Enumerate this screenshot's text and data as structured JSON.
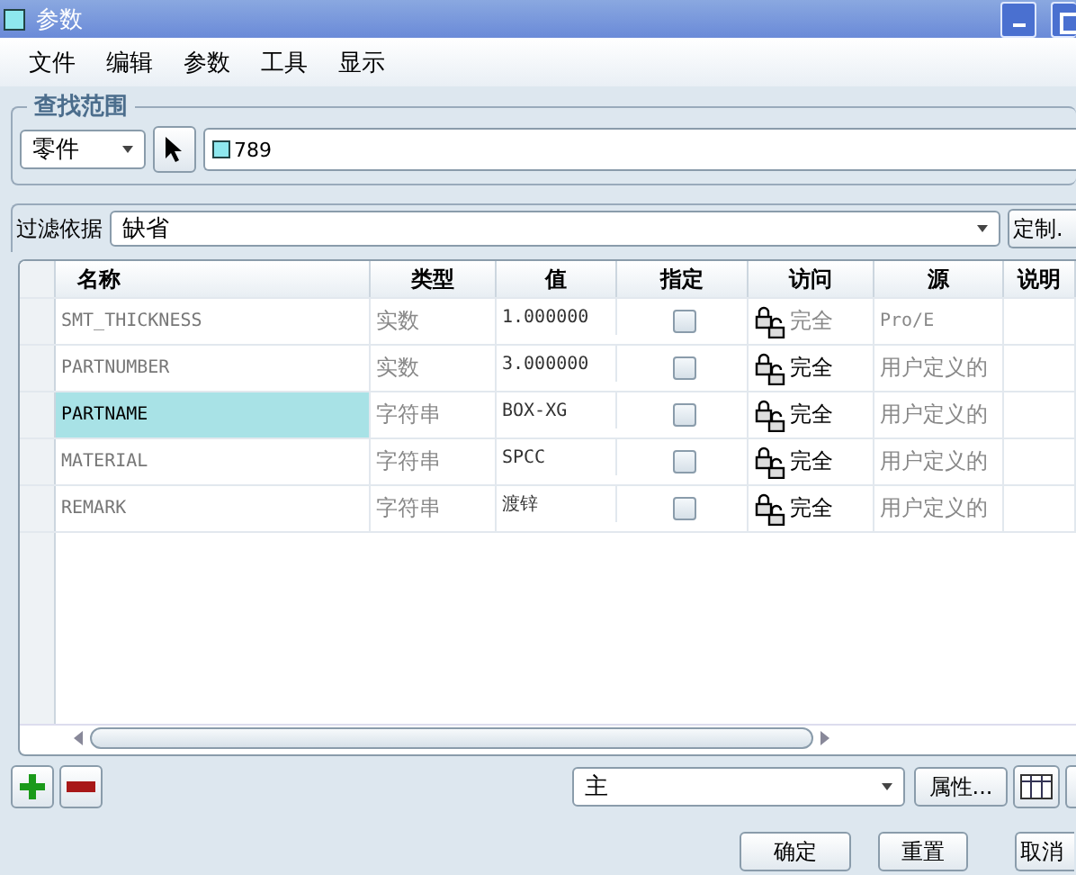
{
  "window": {
    "title": "参数"
  },
  "menu": [
    "文件",
    "编辑",
    "参数",
    "工具",
    "显示"
  ],
  "scope": {
    "title": "查找范围",
    "type_value": "零件",
    "model_value": "789"
  },
  "filter": {
    "label": "过滤依据",
    "value": "缺省",
    "button": "定制."
  },
  "table": {
    "columns": [
      "名称",
      "类型",
      "值",
      "指定",
      "访问",
      "源",
      "说明"
    ],
    "rows": [
      {
        "name": "SMT_THICKNESS",
        "type": "实数",
        "value": "1.000000",
        "designated": false,
        "access": "完全",
        "source": "Pro/E",
        "selected": false,
        "locked": true
      },
      {
        "name": "PARTNUMBER",
        "type": "实数",
        "value": "3.000000",
        "designated": false,
        "access": "完全",
        "source": "用户定义的",
        "selected": false,
        "locked": false
      },
      {
        "name": "PARTNAME",
        "type": "字符串",
        "value": "BOX-XG",
        "designated": false,
        "access": "完全",
        "source": "用户定义的",
        "selected": true,
        "locked": false
      },
      {
        "name": "MATERIAL",
        "type": "字符串",
        "value": "SPCC",
        "designated": false,
        "access": "完全",
        "source": "用户定义的",
        "selected": false,
        "locked": false
      },
      {
        "name": "REMARK",
        "type": "字符串",
        "value": "渡锌",
        "designated": false,
        "access": "完全",
        "source": "用户定义的",
        "selected": false,
        "locked": false
      }
    ]
  },
  "toolbar": {
    "set_value": "主",
    "properties_button": "属性..."
  },
  "buttons": [
    "确定",
    "重置",
    "取消"
  ]
}
